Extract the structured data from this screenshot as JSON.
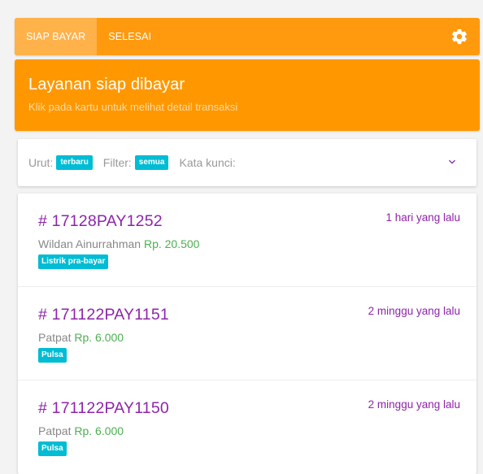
{
  "tabs": [
    {
      "label": "SIAP BAYAR",
      "active": true
    },
    {
      "label": "SELESAI",
      "active": false
    }
  ],
  "banner": {
    "title": "Layanan siap dibayar",
    "subtitle": "Klik pada kartu untuk melihat detail transaksi"
  },
  "filter": {
    "sort_label": "Urut:",
    "sort_value": "terbaru",
    "filter_label": "Filter:",
    "filter_value": "semua",
    "keyword_label": "Kata kunci:"
  },
  "transactions": [
    {
      "id": "# 17128PAY1252",
      "time": "1 hari yang lalu",
      "name": "Wildan Ainurrahman",
      "amount": "Rp. 20.500",
      "type": "Listrik pra-bayar"
    },
    {
      "id": "# 171122PAY1151",
      "time": "2 minggu yang lalu",
      "name": "Patpat",
      "amount": "Rp. 6.000",
      "type": "Pulsa"
    },
    {
      "id": "# 171122PAY1150",
      "time": "2 minggu yang lalu",
      "name": "Patpat",
      "amount": "Rp. 6.000",
      "type": "Pulsa"
    }
  ],
  "icons": {
    "settings": "gear-icon",
    "expand": "chevron-down-icon"
  },
  "colors": {
    "topbar": "#ff9a0f",
    "tab_active": "#ffb14a",
    "banner": "#ff9800",
    "accent_purple": "#8e24aa",
    "amount_green": "#4caf50",
    "chip_cyan": "#00bcd4"
  }
}
